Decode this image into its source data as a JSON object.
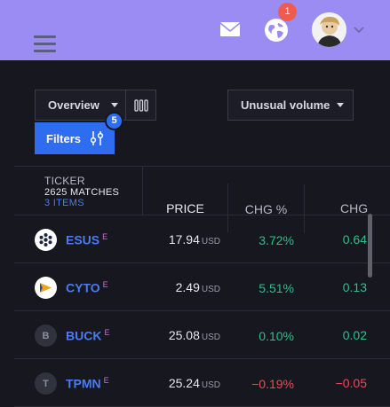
{
  "header": {
    "notification_count": "1",
    "accent": "#9b8cf3",
    "icons": [
      "menu-icon",
      "mail-icon",
      "globe-icon",
      "avatar",
      "chevron-down-icon"
    ]
  },
  "toolbar": {
    "view_select": "Overview",
    "preset_select": "Unusual volume",
    "filters_label": "Filters",
    "filters_count": "5"
  },
  "table": {
    "columns": {
      "ticker": "TICKER",
      "matches": "2625 MATCHES",
      "selected": "3 ITEMS",
      "price": "PRICE",
      "change_pct": "CHG %",
      "change": "CHG"
    },
    "rows": [
      {
        "symbol": "ESUS",
        "flag": "E",
        "price": "17.94",
        "currency": "USD",
        "change_pct": "3.72%",
        "change": "0.64",
        "logo_letter": "",
        "direction": "up"
      },
      {
        "symbol": "CYTO",
        "flag": "E",
        "price": "2.49",
        "currency": "USD",
        "change_pct": "5.51%",
        "change": "0.13",
        "logo_letter": "",
        "direction": "up"
      },
      {
        "symbol": "BUCK",
        "flag": "E",
        "price": "25.08",
        "currency": "USD",
        "change_pct": "0.10%",
        "change": "0.02",
        "logo_letter": "B",
        "direction": "up"
      },
      {
        "symbol": "TPMN",
        "flag": "E",
        "price": "25.24",
        "currency": "USD",
        "change_pct": "−0.19%",
        "change": "−0.05",
        "logo_letter": "T",
        "direction": "down"
      }
    ],
    "colors": {
      "up": "#2fbf8a",
      "down": "#ef4a57",
      "symbol": "#4b7cf0"
    }
  }
}
